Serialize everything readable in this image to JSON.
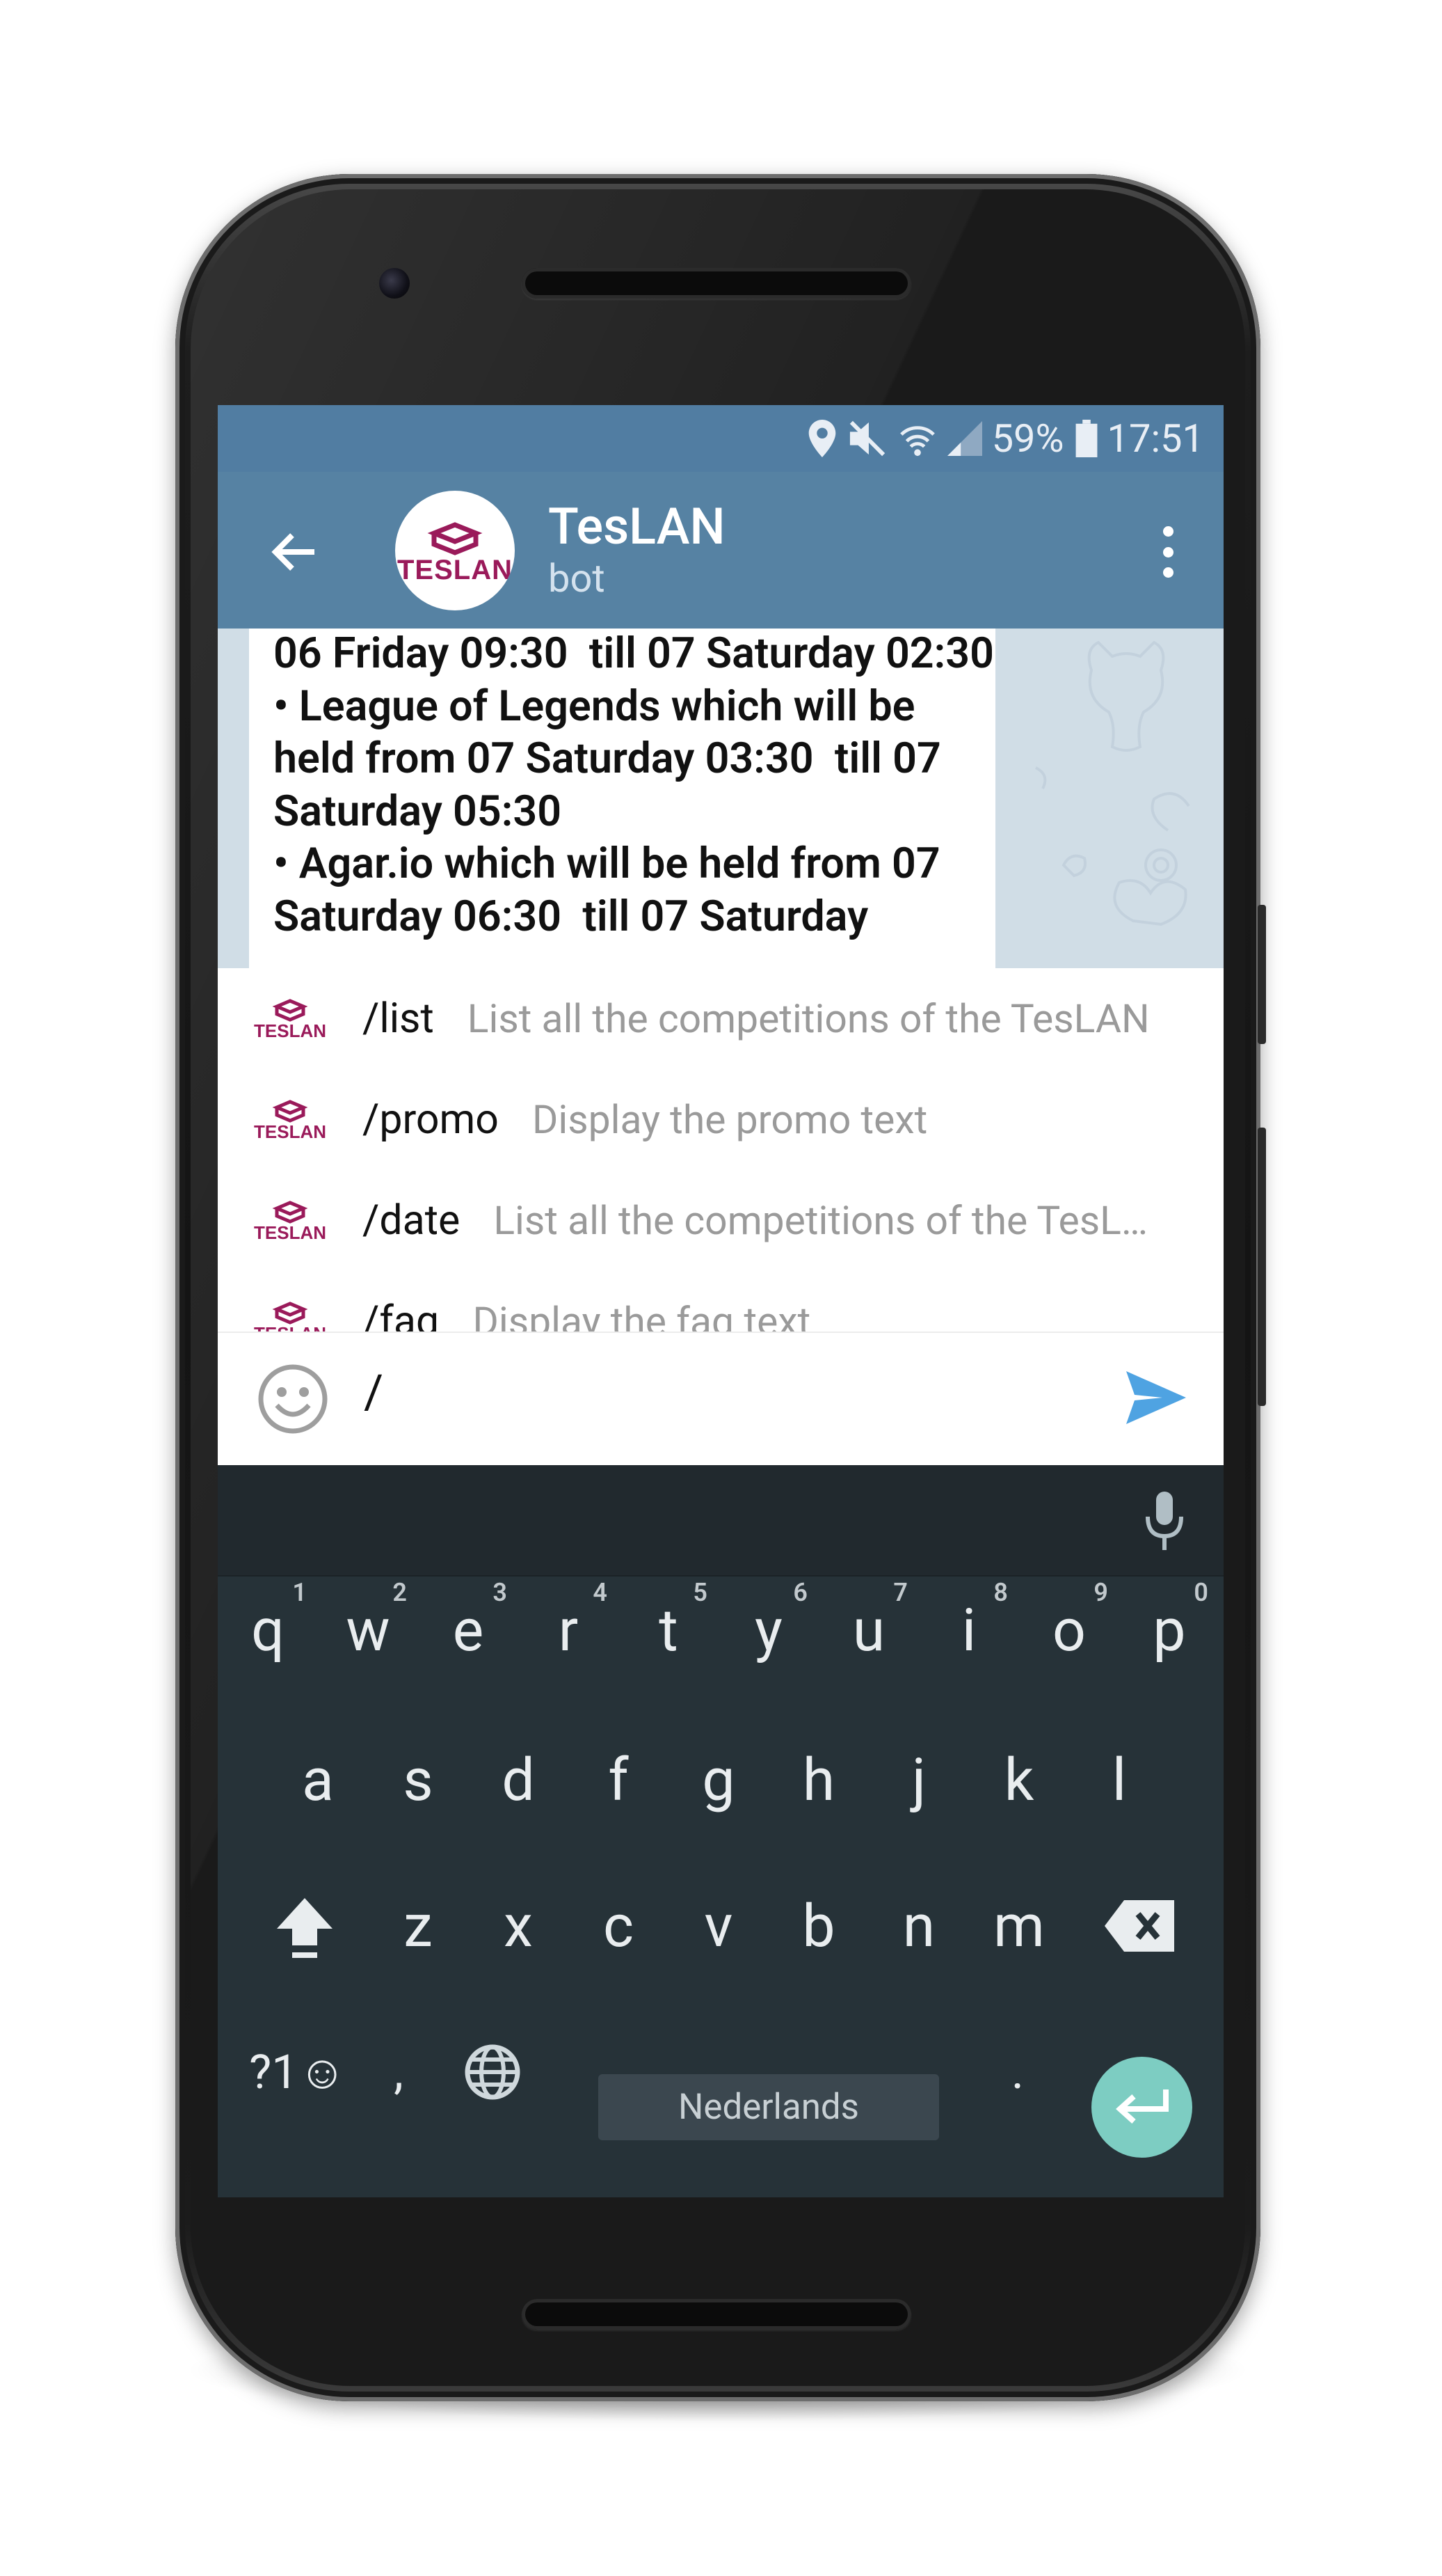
{
  "status_bar": {
    "battery": "59%",
    "time": "17:51",
    "icons": [
      "location-icon",
      "mute-icon",
      "wifi-icon",
      "signal-icon",
      "battery-icon"
    ]
  },
  "header": {
    "title": "TesLAN",
    "subtitle": "bot",
    "logo_text": "TESLAN",
    "back_icon": "arrow-left-icon",
    "menu_icon": "more-vertical-icon"
  },
  "chat": {
    "message_text": "06 Friday 09:30  till 07 Saturday 02:30\n• League of Legends which will be held from 07 Saturday 03:30  till 07 Saturday 05:30\n• Agar.io which will be held from 07 Saturday 06:30  till 07 Saturday"
  },
  "suggestions": [
    {
      "command": "/list",
      "description": "List all the competitions of the TesLAN"
    },
    {
      "command": "/promo",
      "description": "Display the promo text"
    },
    {
      "command": "/date",
      "description": "List all the competitions of the TesL…"
    },
    {
      "command": "/faq",
      "description": "Display the faq text"
    }
  ],
  "input": {
    "value": "/",
    "emoji_icon": "smiley-icon",
    "send_icon": "send-icon"
  },
  "keyboard": {
    "mic_icon": "microphone-icon",
    "row1": [
      {
        "key": "q",
        "hint": "1"
      },
      {
        "key": "w",
        "hint": "2"
      },
      {
        "key": "e",
        "hint": "3"
      },
      {
        "key": "r",
        "hint": "4"
      },
      {
        "key": "t",
        "hint": "5"
      },
      {
        "key": "y",
        "hint": "6"
      },
      {
        "key": "u",
        "hint": "7"
      },
      {
        "key": "i",
        "hint": "8"
      },
      {
        "key": "o",
        "hint": "9"
      },
      {
        "key": "p",
        "hint": "0"
      }
    ],
    "row2": [
      "a",
      "s",
      "d",
      "f",
      "g",
      "h",
      "j",
      "k",
      "l"
    ],
    "row3": [
      "z",
      "x",
      "c",
      "v",
      "b",
      "n",
      "m"
    ],
    "symbols_label": "?1☺",
    "comma": ",",
    "period": ".",
    "space_label": "Nederlands",
    "shift_icon": "shift-icon",
    "backspace_icon": "backspace-icon",
    "globe_icon": "globe-icon",
    "enter_icon": "enter-icon"
  }
}
